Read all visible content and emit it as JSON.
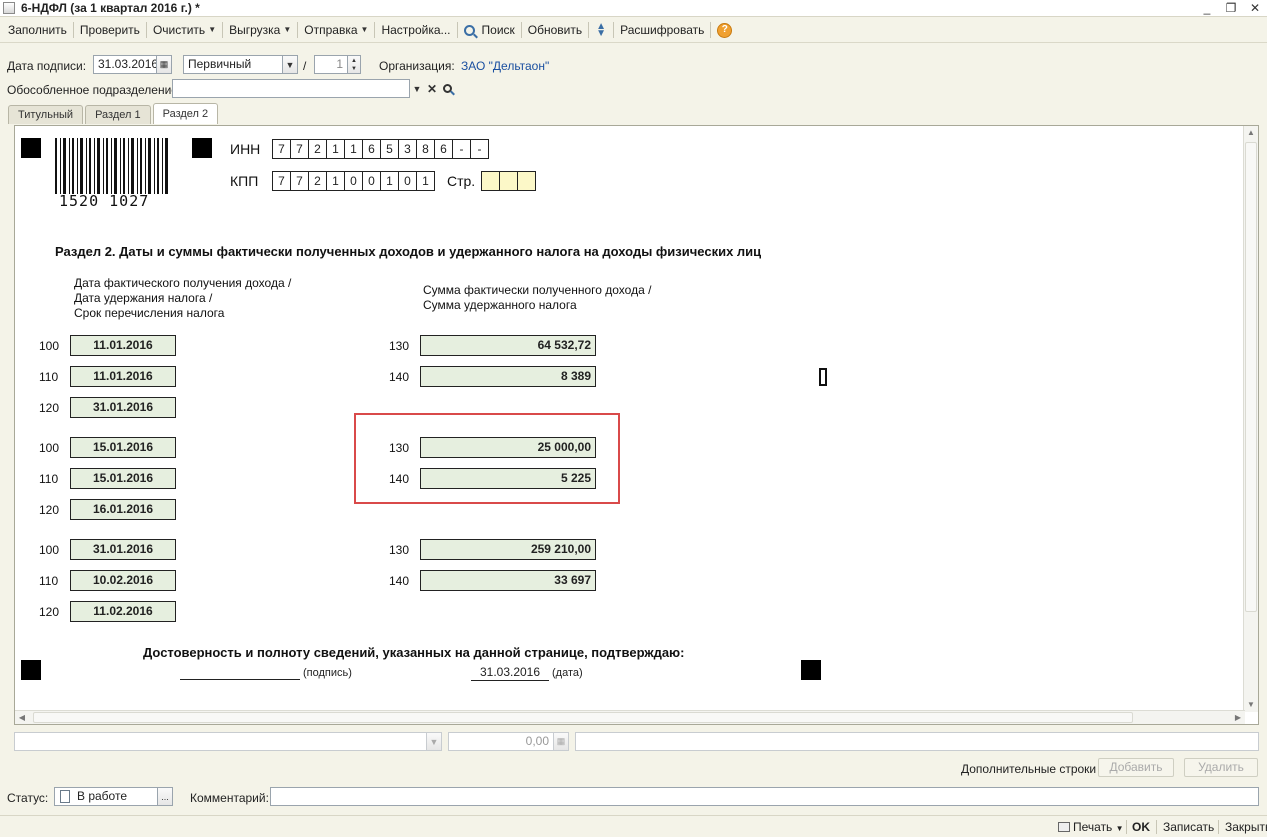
{
  "window": {
    "title": "6-НДФЛ (за 1 квартал 2016 г.) *",
    "controls": [
      "_",
      "❐",
      "✕"
    ]
  },
  "toolbar": {
    "fill": "Заполнить",
    "check": "Проверить",
    "clear": "Очистить",
    "export": "Выгрузка",
    "send": "Отправка",
    "settings": "Настройка...",
    "search": "Поиск",
    "refresh": "Обновить",
    "decode": "Расшифровать",
    "help": "?"
  },
  "header": {
    "sign_date_label": "Дата подписи:",
    "sign_date": "31.03.2016",
    "doc_type": "Первичный",
    "slash": "/",
    "correction_number": "1",
    "org_label": "Организация:",
    "org_name": "ЗАО \"Дельтаон\"",
    "subdivision_label": "Обособленное подразделение:",
    "subdivision_value": ""
  },
  "tabs": [
    "Титульный",
    "Раздел 1",
    "Раздел 2"
  ],
  "form": {
    "barcode_number": "1520 1027",
    "inn_label": "ИНН",
    "inn": [
      "7",
      "7",
      "2",
      "1",
      "1",
      "6",
      "5",
      "3",
      "8",
      "6",
      "-",
      "-"
    ],
    "kpp_label": "КПП",
    "kpp": [
      "7",
      "7",
      "2",
      "1",
      "0",
      "0",
      "1",
      "0",
      "1"
    ],
    "page_label": "Стр.",
    "page": [
      "",
      "",
      ""
    ],
    "section_title": "Раздел 2.  Даты и суммы фактически полученных доходов и удержанного налога на доходы физических лиц",
    "col_left": [
      "Дата фактического получения дохода /",
      "Дата удержания налога /",
      "Срок перечисления налога"
    ],
    "col_right": [
      "Сумма фактически полученного дохода /",
      "Сумма удержанного налога"
    ],
    "blocks": [
      {
        "rows": [
          {
            "code": "100",
            "date": "11.01.2016",
            "scode": "130",
            "sum": "64 532,72"
          },
          {
            "code": "110",
            "date": "11.01.2016",
            "scode": "140",
            "sum": "8 389"
          },
          {
            "code": "120",
            "date": "31.01.2016"
          }
        ]
      },
      {
        "rows": [
          {
            "code": "100",
            "date": "15.01.2016",
            "scode": "130",
            "sum": "25 000,00"
          },
          {
            "code": "110",
            "date": "15.01.2016",
            "scode": "140",
            "sum": "5 225"
          },
          {
            "code": "120",
            "date": "16.01.2016"
          }
        ]
      },
      {
        "rows": [
          {
            "code": "100",
            "date": "31.01.2016",
            "scode": "130",
            "sum": "259 210,00"
          },
          {
            "code": "110",
            "date": "10.02.2016",
            "scode": "140",
            "sum": "33 697"
          },
          {
            "code": "120",
            "date": "11.02.2016"
          }
        ]
      }
    ],
    "confirm_text": "Достоверность и полноту сведений, указанных на данной странице, подтверждаю:",
    "signature_label": "(подпись)",
    "confirm_date": "31.03.2016",
    "date_label": "(дата)"
  },
  "bottom": {
    "amount": "0,00",
    "extra_rows_label": "Дополнительные строки",
    "add_button": "Добавить",
    "delete_button": "Удалить"
  },
  "status": {
    "label": "Статус:",
    "value": "В работе",
    "more": "...",
    "comment_label": "Комментарий:",
    "comment_value": ""
  },
  "footer": {
    "print": "Печать",
    "ok": "OK",
    "save": "Записать",
    "close": "Закрыть"
  }
}
